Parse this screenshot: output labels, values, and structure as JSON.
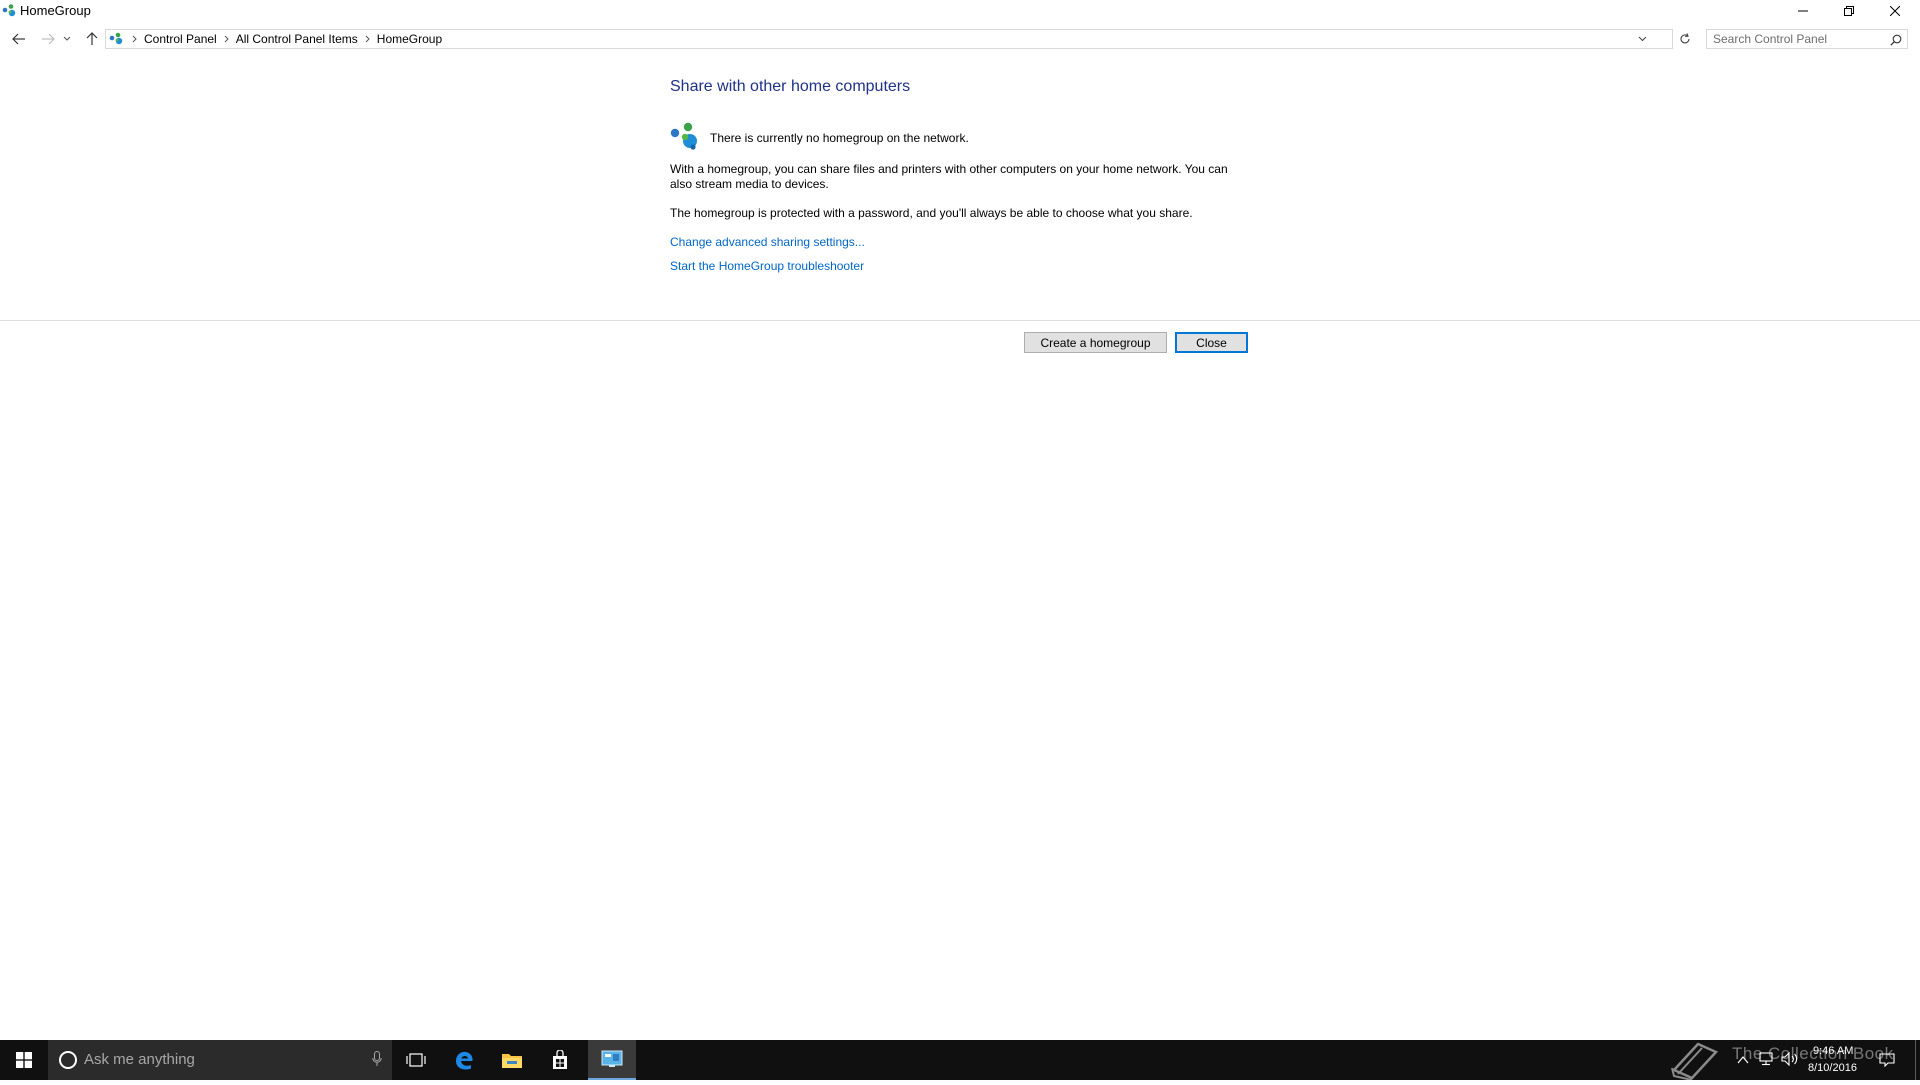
{
  "window": {
    "title": "HomeGroup",
    "minimize_label": "Minimize",
    "restore_label": "Restore Down",
    "close_label": "Close"
  },
  "address_bar": {
    "breadcrumbs": [
      "Control Panel",
      "All Control Panel Items",
      "HomeGroup"
    ]
  },
  "search": {
    "placeholder": "Search Control Panel"
  },
  "content": {
    "title": "Share with other home computers",
    "status": "There is currently no homegroup on the network.",
    "paragraph1": "With a homegroup, you can share files and printers with other computers on your home network. You can also stream media to devices.",
    "paragraph2": "The homegroup is protected with a password, and you'll always be able to choose what you share.",
    "link_sharing": "Change advanced sharing settings...",
    "link_troubleshooter": "Start the HomeGroup troubleshooter"
  },
  "buttons": {
    "create": "Create a homegroup",
    "close": "Close"
  },
  "taskbar": {
    "search_placeholder": "Ask me anything",
    "time": "9:46 AM",
    "date": "8/10/2016",
    "watermark": "The Collection Book"
  },
  "colors": {
    "title_blue": "#1e3287",
    "link_blue": "#0066cc",
    "taskbar": "#101010",
    "focus_blue": "#0078d7"
  }
}
